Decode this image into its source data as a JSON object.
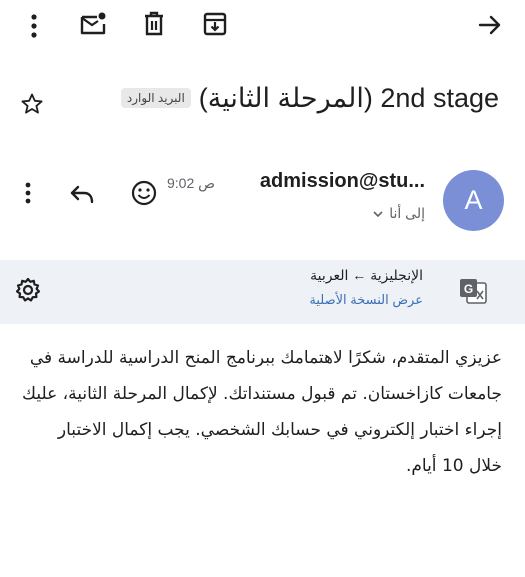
{
  "toolbar": {
    "icons": [
      "more-vertical-icon",
      "mark-unread-icon",
      "delete-icon",
      "archive-icon",
      "back-arrow-icon"
    ]
  },
  "message": {
    "subject": "(المرحلة الثانية) 2nd stage",
    "label": "البريد الوارد",
    "sender_initial": "A",
    "sender": "admission@stu...",
    "time": "9:02 ص",
    "recipient": "إلى أنا"
  },
  "translation": {
    "languages": "الإنجليزية ← العربية",
    "show_original": "عرض النسخة الأصلية"
  },
  "body": "عزيزي المتقدم، شكرًا لاهتمامك ببرنامج المنح الدراسية للدراسة في جامعات كازاخستان. تم قبول مستنداتك. لإكمال المرحلة الثانية، عليك إجراء اختبار إلكتروني في حسابك الشخصي. يجب إكمال الاختبار خلال 10 أيام.",
  "colors": {
    "avatar": "#7a8fd6",
    "translation_bar": "#eef2f7",
    "link": "#3b6fb5"
  }
}
